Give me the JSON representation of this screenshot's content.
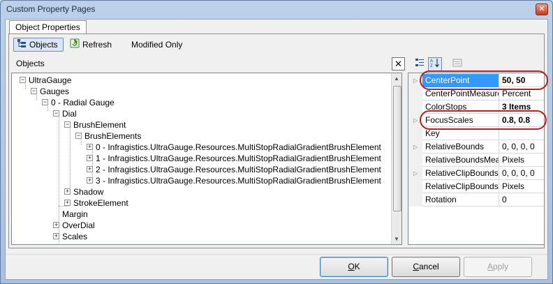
{
  "window": {
    "title": "Custom Property Pages",
    "close_glyph": "✕"
  },
  "tabs": [
    {
      "label": "Object Properties",
      "active": true
    }
  ],
  "toolbar": {
    "objects_label": "Objects",
    "refresh_label": "Refresh",
    "modified_only_label": "Modified Only"
  },
  "objects_panel": {
    "label": "Objects",
    "close_glyph": "✕"
  },
  "tree": [
    {
      "label": "UltraGauge",
      "depth": 0,
      "expander": "−"
    },
    {
      "label": "Gauges",
      "depth": 1,
      "expander": "−"
    },
    {
      "label": "0 - Radial Gauge",
      "depth": 2,
      "expander": "−"
    },
    {
      "label": "Dial",
      "depth": 3,
      "expander": "−"
    },
    {
      "label": "BrushElement",
      "depth": 4,
      "expander": "−"
    },
    {
      "label": "BrushElements",
      "depth": 5,
      "expander": "−"
    },
    {
      "label": "0 - Infragistics.UltraGauge.Resources.MultiStopRadialGradientBrushElement",
      "depth": 6,
      "expander": "+"
    },
    {
      "label": "1 - Infragistics.UltraGauge.Resources.MultiStopRadialGradientBrushElement",
      "depth": 6,
      "expander": "+"
    },
    {
      "label": "2 - Infragistics.UltraGauge.Resources.MultiStopRadialGradientBrushElement",
      "depth": 6,
      "expander": "+"
    },
    {
      "label": "3 - Infragistics.UltraGauge.Resources.MultiStopRadialGradientBrushElement",
      "depth": 6,
      "expander": "+"
    },
    {
      "label": "Shadow",
      "depth": 4,
      "expander": "+"
    },
    {
      "label": "StrokeElement",
      "depth": 4,
      "expander": "+"
    },
    {
      "label": "Margin",
      "depth": 3,
      "expander": ""
    },
    {
      "label": "OverDial",
      "depth": 3,
      "expander": "+"
    },
    {
      "label": "Scales",
      "depth": 3,
      "expander": "+"
    }
  ],
  "properties": [
    {
      "name": "CenterPoint",
      "value": "50, 50",
      "bold": true,
      "selected": true,
      "expandable": true,
      "highlighted": true
    },
    {
      "name": "CenterPointMeasure",
      "value": "Percent",
      "bold": false,
      "selected": false,
      "expandable": false,
      "highlighted": false
    },
    {
      "name": "ColorStops",
      "value": "3 Items",
      "bold": true,
      "selected": false,
      "expandable": false,
      "highlighted": false
    },
    {
      "name": "FocusScales",
      "value": "0.8, 0.8",
      "bold": true,
      "selected": false,
      "expandable": true,
      "highlighted": true
    },
    {
      "name": "Key",
      "value": "",
      "bold": false,
      "selected": false,
      "expandable": false,
      "highlighted": false
    },
    {
      "name": "RelativeBounds",
      "value": "0, 0, 0, 0",
      "bold": false,
      "selected": false,
      "expandable": true,
      "highlighted": false
    },
    {
      "name": "RelativeBoundsMeasure",
      "value": "Pixels",
      "bold": false,
      "selected": false,
      "expandable": false,
      "highlighted": false
    },
    {
      "name": "RelativeClipBounds",
      "value": "0, 0, 0, 0",
      "bold": false,
      "selected": false,
      "expandable": true,
      "highlighted": false
    },
    {
      "name": "RelativeClipBoundsMeasure",
      "value": "Pixels",
      "bold": false,
      "selected": false,
      "expandable": false,
      "highlighted": false
    },
    {
      "name": "Rotation",
      "value": "0",
      "bold": false,
      "selected": false,
      "expandable": false,
      "highlighted": false
    }
  ],
  "buttons": {
    "ok": {
      "label": "OK",
      "mnemonic": "O",
      "rest": "K"
    },
    "cancel": {
      "label": "Cancel",
      "mnemonic": "C",
      "rest": "ancel"
    },
    "apply": {
      "label": "Apply",
      "mnemonic": "A",
      "rest": "pply",
      "disabled": true
    }
  },
  "colors": {
    "highlight_oval": "#b52020",
    "selection": "#3399ff"
  }
}
